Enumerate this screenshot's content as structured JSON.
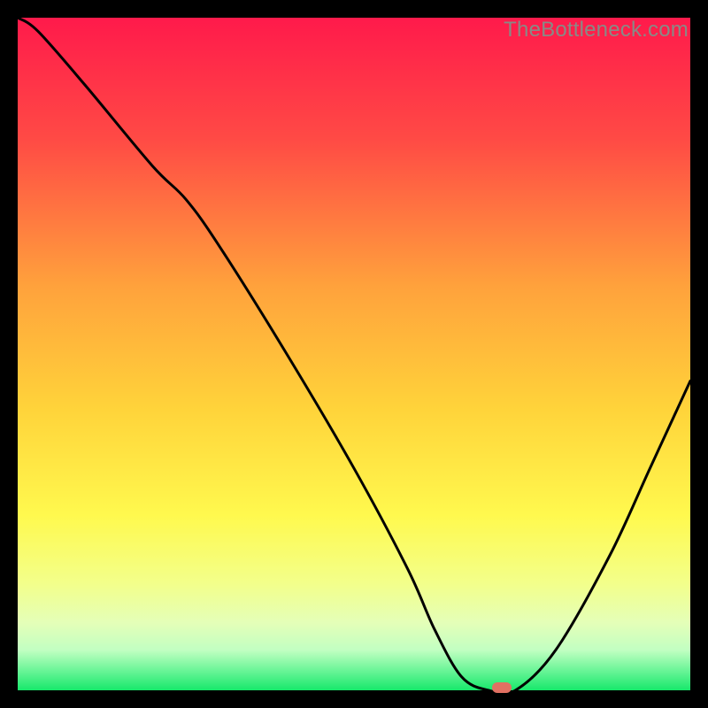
{
  "watermark": "TheBottleneck.com",
  "colors": {
    "top": "#ff1a4b",
    "mid_upper": "#ff7b3d",
    "mid": "#ffd33a",
    "mid_lower": "#f6ff55",
    "band_light": "#e9ffb0",
    "green": "#17e86b",
    "curve": "#000000",
    "dot": "#e17062",
    "bg": "#000000"
  },
  "chart_data": {
    "type": "line",
    "title": "",
    "xlabel": "",
    "ylabel": "",
    "xlim": [
      0,
      100
    ],
    "ylim": [
      0,
      100
    ],
    "x": [
      0,
      3,
      10,
      20,
      25,
      30,
      40,
      50,
      58,
      62,
      66,
      70,
      74,
      80,
      88,
      94,
      100
    ],
    "values": [
      100,
      98,
      90,
      78,
      73,
      66,
      50,
      33,
      18,
      9,
      2,
      0,
      0,
      6,
      20,
      33,
      46
    ],
    "marker": {
      "x": 72,
      "y": 0
    },
    "notes": "V-shaped bottleneck curve over rainbow gradient; minimum flat region around x≈70–74; curve estimated from pixels (no axis ticks shown)."
  }
}
